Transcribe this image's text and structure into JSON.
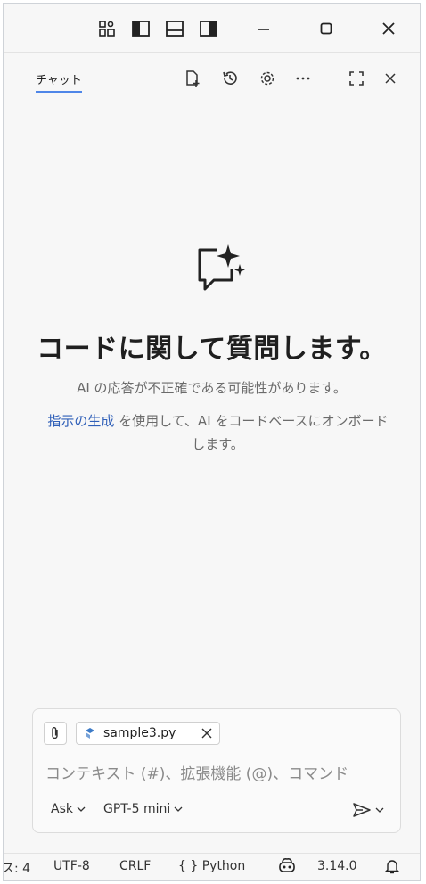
{
  "window": {
    "controls": [
      "layout-customize-icon",
      "toggle-primary-sidebar-icon",
      "toggle-panel-icon",
      "toggle-secondary-sidebar-icon",
      "minimize-icon",
      "maximize-icon",
      "close-icon"
    ]
  },
  "chat_header": {
    "tab_label": "チャット",
    "actions": [
      "new-chat-icon",
      "history-icon",
      "settings-gear-icon",
      "more-icon",
      "maximize-view-icon",
      "close-icon"
    ]
  },
  "welcome": {
    "title": "コードに関して質問します。",
    "subtitle": "AI の応答が不正確である可能性があります。",
    "onboard_link": "指示の生成",
    "onboard_text": " を使用して、AI をコードベースにオンボードします。"
  },
  "input": {
    "file_chip": "sample3.py",
    "placeholder": "コンテキスト (#)、拡張機能 (@)、コマンド",
    "mode": "Ask",
    "model": "GPT-5 mini"
  },
  "status_bar": {
    "indent": "ス: 4",
    "encoding": "UTF-8",
    "eol": "CRLF",
    "language": "{ } Python",
    "version": "3.14.0"
  },
  "colors": {
    "accent": "#4f86e8",
    "link": "#2f5fb8",
    "python_icon": "#3d7bc7"
  }
}
